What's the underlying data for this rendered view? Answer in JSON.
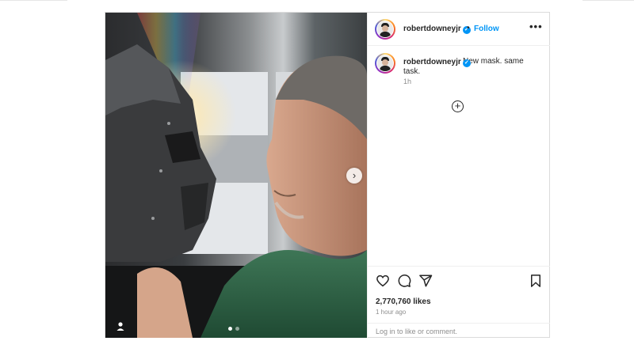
{
  "post": {
    "username": "robertdowneyjr",
    "verified_icon": "verified-badge-icon",
    "separator": "•",
    "follow_label": "Follow",
    "more_label": "•••",
    "caption": "New mask. same task.",
    "caption_time": "1h",
    "load_more_icon": "plus-circle-icon",
    "likes": "2,770,760 likes",
    "posted_time": "1 hour ago",
    "login_prompt": "Log in to like or comment.",
    "carousel_next": "›",
    "carousel_slides": 2,
    "carousel_active_index": 0,
    "colors": {
      "link_blue": "#0095f6",
      "text": "#262626",
      "secondary": "#8e8e8e",
      "border": "#dbdbdb"
    },
    "action_icons": [
      "heart-icon",
      "comment-icon",
      "share-icon",
      "bookmark-icon"
    ]
  }
}
